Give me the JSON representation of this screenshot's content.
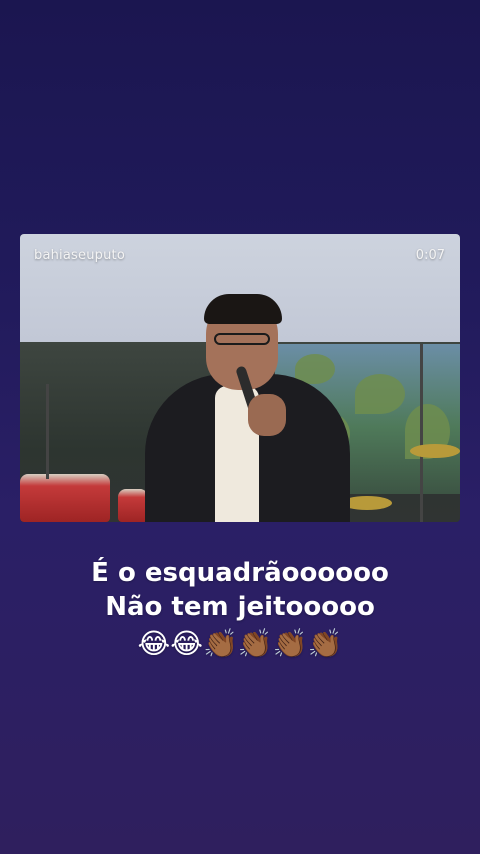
{
  "story": {
    "video": {
      "username": "bahiaseuputo",
      "time": "0:07"
    },
    "caption": {
      "line1": "É o esquadrãoooooo",
      "line2": "Não tem jeitooooo",
      "emojis": "😂😂👏🏾👏🏾👏🏾👏🏾"
    }
  }
}
